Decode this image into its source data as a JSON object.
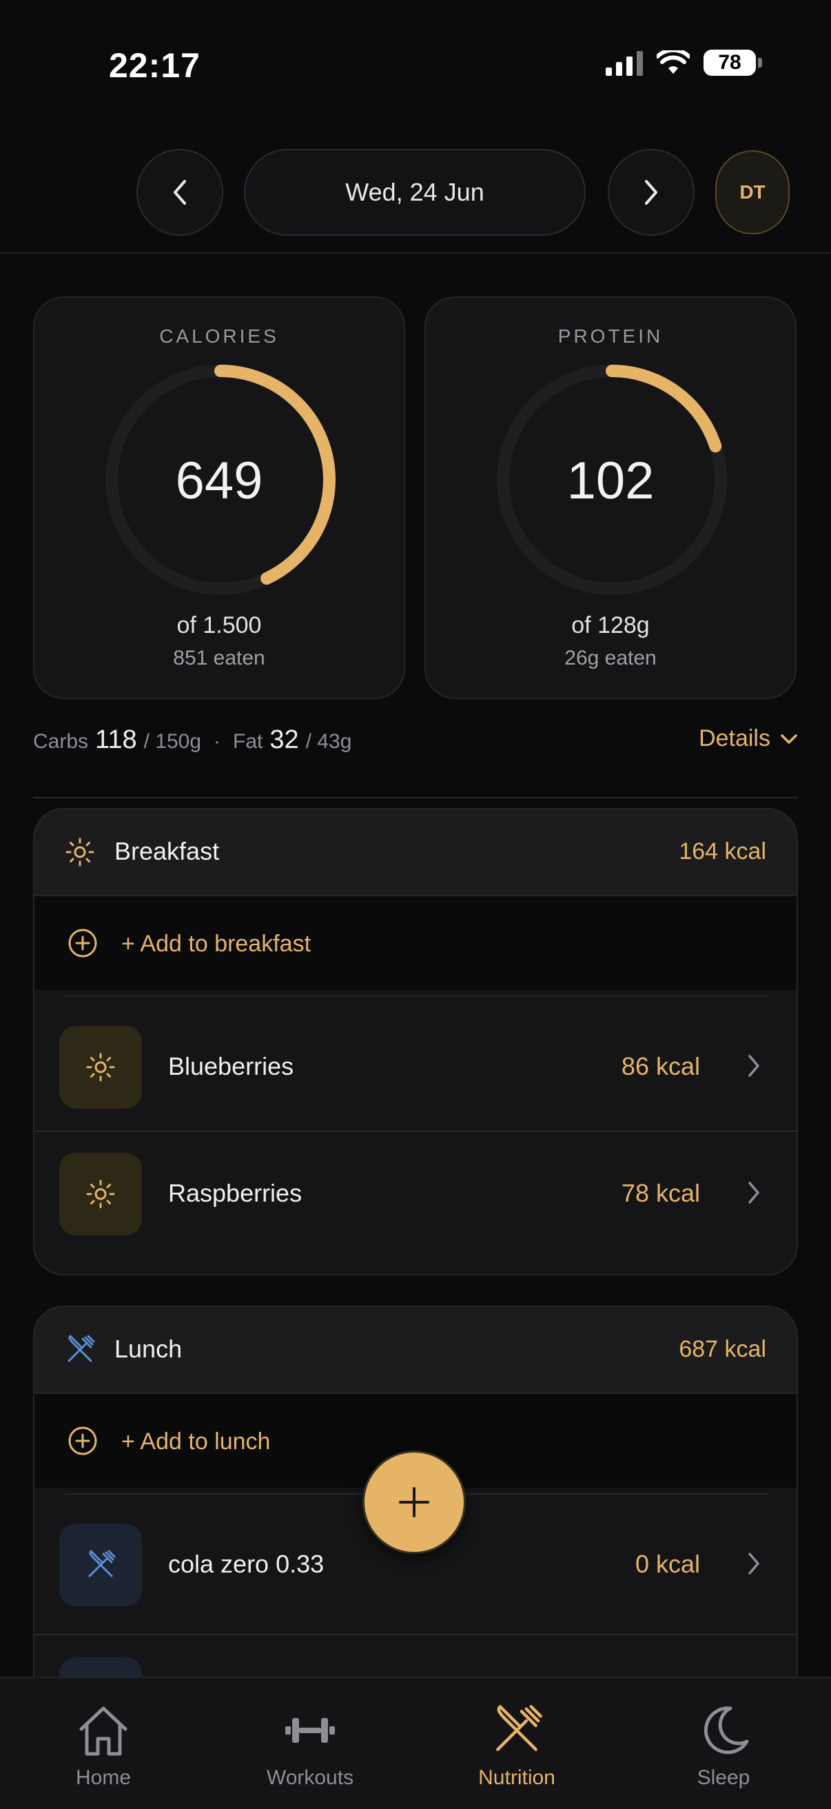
{
  "status_bar": {
    "time": "22:17",
    "battery": "78"
  },
  "header": {
    "date": "Wed, 24 Jun",
    "avatar_initials": "DT"
  },
  "calories": {
    "label": "CALORIES",
    "value": "649",
    "goal_text": "of 1.500",
    "eaten_text": "851 eaten",
    "ring_fraction": 0.43
  },
  "protein": {
    "label": "PROTEIN",
    "value": "102",
    "goal_text": "of 128g",
    "eaten_text": "26g eaten",
    "ring_fraction": 0.2
  },
  "macros": {
    "carbs_label": "Carbs",
    "carbs_value": "118",
    "carbs_goal": "/ 150g",
    "dot": "·",
    "fat_label": "Fat",
    "fat_value": "32",
    "fat_goal": "/ 43g",
    "details_label": "Details"
  },
  "meals": [
    {
      "title": "Breakfast",
      "kcal": "164 kcal",
      "add_label": "+ Add to breakfast",
      "items": [
        {
          "name": "Blueberries",
          "kcal": "86 kcal"
        },
        {
          "name": "Raspberries",
          "kcal": "78 kcal"
        }
      ]
    },
    {
      "title": "Lunch",
      "kcal": "687 kcal",
      "add_label": "+ Add to lunch",
      "items": [
        {
          "name": "cola zero 0.33",
          "kcal": "0 kcal"
        }
      ]
    }
  ],
  "tabs": [
    {
      "label": "Home",
      "icon": "home-icon"
    },
    {
      "label": "Workouts",
      "icon": "dumbbell-icon"
    },
    {
      "label": "Nutrition",
      "icon": "fork-knife-icon",
      "active": true
    },
    {
      "label": "Sleep",
      "icon": "moon-icon"
    }
  ],
  "colors": {
    "accent": "#e5b467",
    "background": "#0b0b0d",
    "card": "#151517",
    "lunch_icon": "#5b8fd6"
  }
}
